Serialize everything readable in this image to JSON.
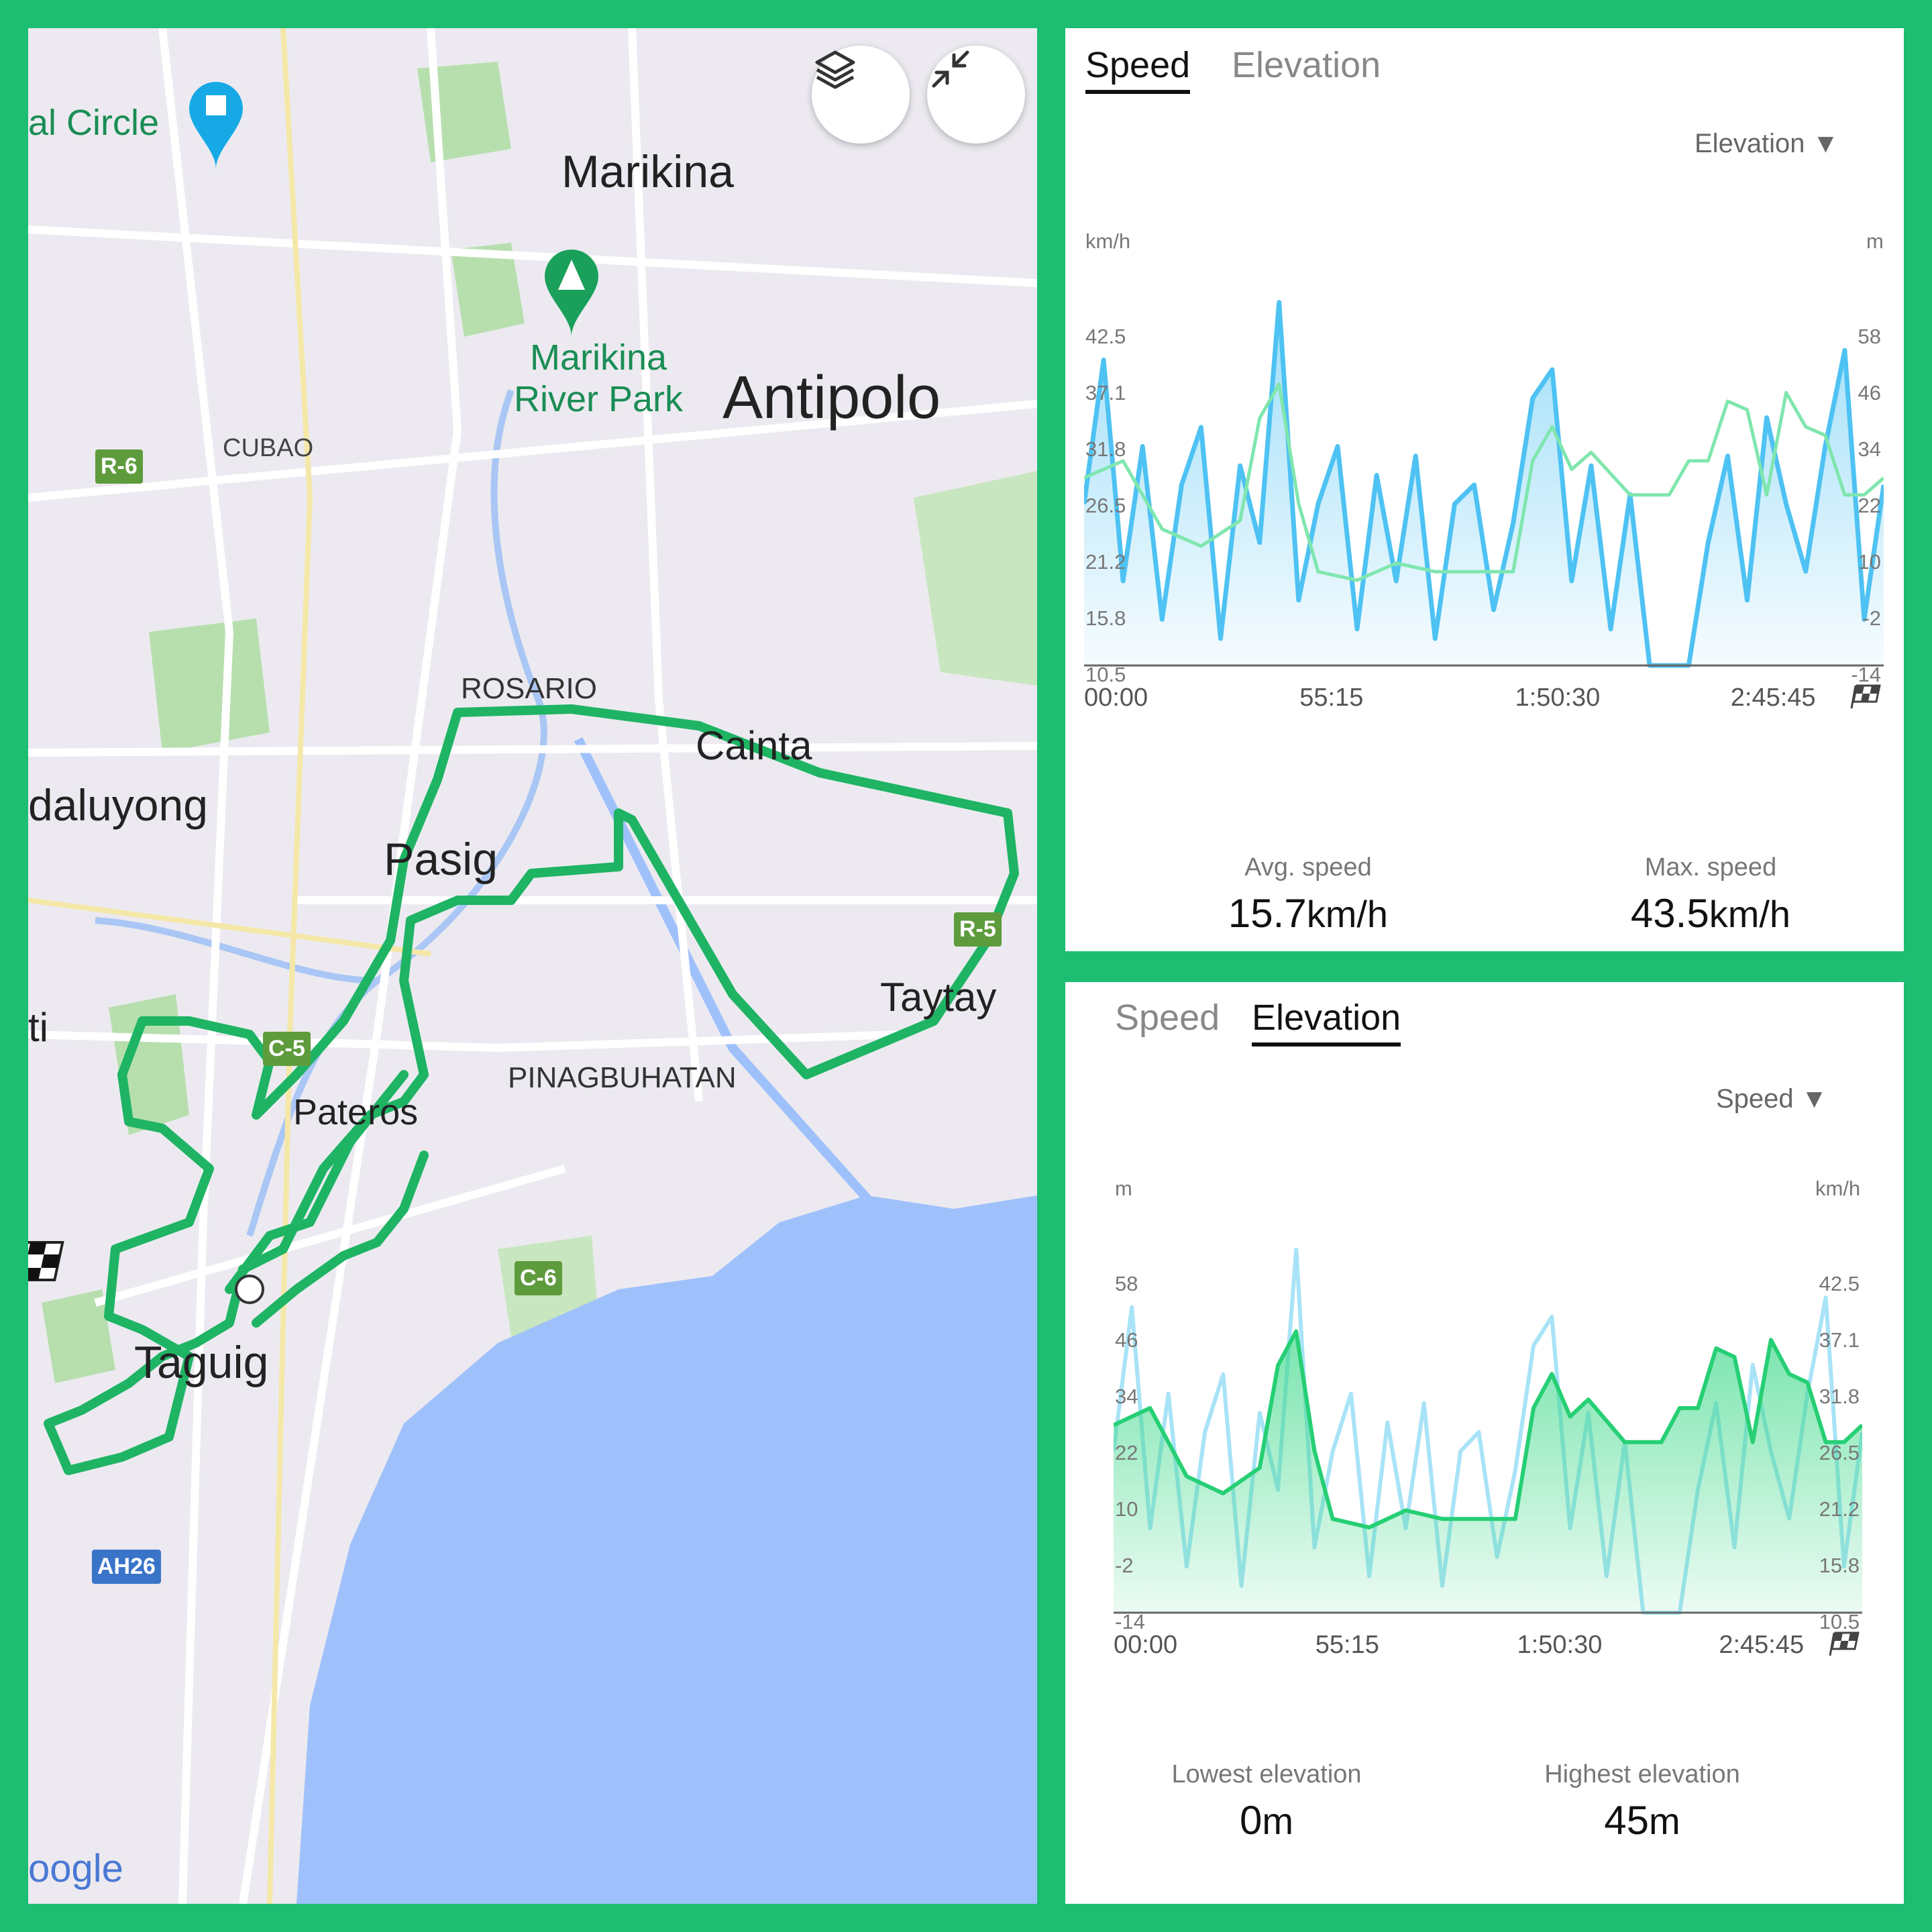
{
  "map": {
    "places": [
      {
        "name": "al Circle"
      },
      {
        "name": "Marikina"
      },
      {
        "name": "Marikina River Park"
      },
      {
        "name": "Antipolo"
      },
      {
        "name": "CUBAO"
      },
      {
        "name": "ROSARIO"
      },
      {
        "name": "Cainta"
      },
      {
        "name": "daluyong"
      },
      {
        "name": "Pasig"
      },
      {
        "name": "Taytay"
      },
      {
        "name": "ti"
      },
      {
        "name": "PINAGBUHATAN"
      },
      {
        "name": "Pateros"
      },
      {
        "name": "Taguig"
      },
      {
        "name": "oogle"
      }
    ],
    "shields": [
      {
        "label": "R-6",
        "color": "#5e9b3c"
      },
      {
        "label": "C-5",
        "color": "#5e9b3c"
      },
      {
        "label": "R-5",
        "color": "#5e9b3c"
      },
      {
        "label": "C-6",
        "color": "#5e9b3c"
      },
      {
        "label": "AH26",
        "color": "#3a74c9"
      }
    ],
    "route_color": "#1eb464",
    "water_color": "#9fc1fb",
    "park_color": "#b7dfae",
    "buttons": [
      {
        "icon": "layers-icon"
      },
      {
        "icon": "collapse-icon"
      }
    ]
  },
  "speed_card": {
    "tabs": [
      {
        "label": "Speed"
      },
      {
        "label": "Elevation"
      }
    ],
    "active_tab": "Speed",
    "dropdown": "Elevation ▼",
    "left_unit": "km/h",
    "right_unit": "m",
    "stats": [
      {
        "label": "Avg. speed",
        "value": "15.7",
        "unit": "km/h"
      },
      {
        "label": "Max. speed",
        "value": "43.5",
        "unit": "km/h"
      }
    ]
  },
  "elevation_card": {
    "tabs": [
      {
        "label": "Speed"
      },
      {
        "label": "Elevation"
      }
    ],
    "active_tab": "Elevation",
    "dropdown": "Speed ▼",
    "left_unit": "m",
    "right_unit": "km/h",
    "stats": [
      {
        "label": "Lowest elevation",
        "value": "0",
        "unit": "m"
      },
      {
        "label": "Highest elevation",
        "value": "45",
        "unit": "m"
      }
    ]
  },
  "chart_data": [
    {
      "type": "area",
      "primary": "speed",
      "x_ticks": [
        "00:00",
        "55:15",
        "1:50:30",
        "2:45:45"
      ],
      "end_marker": "finish-flag-icon",
      "speed_ticks": [
        "42.5",
        "37.1",
        "31.8",
        "26.5",
        "21.2",
        "15.8",
        "10.5"
      ],
      "elevation_ticks": [
        "58",
        "46",
        "34",
        "22",
        "10",
        "-2",
        "-14"
      ],
      "speed_ylim": [
        5.2,
        47.8
      ],
      "elevation_ylim": [
        -26,
        70
      ],
      "x_range_seconds": [
        0,
        12300
      ],
      "speed_color": "#4ec2f3",
      "elevation_color": "#6fe0a4",
      "series": [
        {
          "name": "Speed",
          "unit": "km/h",
          "x": [
            0,
            300,
            600,
            900,
            1200,
            1500,
            1800,
            2100,
            2400,
            2700,
            3000,
            3300,
            3600,
            3900,
            4200,
            4500,
            4800,
            5100,
            5400,
            5700,
            6000,
            6300,
            6600,
            6900,
            7200,
            7500,
            7800,
            8100,
            8400,
            8700,
            9000,
            9300,
            9600,
            9900,
            10200,
            10500,
            10800,
            11100,
            11400,
            11700,
            12000,
            12300
          ],
          "values": [
            22,
            37,
            14,
            28,
            10,
            24,
            30,
            8,
            26,
            18,
            43,
            12,
            22,
            28,
            9,
            25,
            14,
            27,
            8,
            22,
            24,
            11,
            20,
            33,
            36,
            14,
            26,
            9,
            23,
            0,
            0,
            0,
            18,
            27,
            12,
            31,
            22,
            15,
            28,
            38,
            10,
            24
          ]
        },
        {
          "name": "Elevation",
          "unit": "m",
          "x": [
            0,
            600,
            1200,
            1800,
            2400,
            2700,
            3000,
            3300,
            3600,
            4200,
            4800,
            5400,
            6000,
            6600,
            6900,
            7200,
            7500,
            7800,
            8400,
            9000,
            9300,
            9600,
            9900,
            10200,
            10500,
            10800,
            11100,
            11400,
            11700,
            12000,
            12300
          ],
          "values": [
            18,
            22,
            6,
            2,
            8,
            32,
            40,
            12,
            -4,
            -6,
            -2,
            -4,
            -4,
            -4,
            22,
            30,
            20,
            24,
            14,
            14,
            22,
            22,
            36,
            34,
            14,
            38,
            30,
            28,
            14,
            14,
            18
          ]
        }
      ]
    },
    {
      "type": "area",
      "primary": "elevation",
      "x_ticks": [
        "00:00",
        "55:15",
        "1:50:30",
        "2:45:45"
      ],
      "end_marker": "finish-flag-icon",
      "elevation_ticks": [
        "58",
        "46",
        "34",
        "22",
        "10",
        "-2",
        "-14"
      ],
      "speed_ticks": [
        "42.5",
        "37.1",
        "31.8",
        "26.5",
        "21.2",
        "15.8",
        "10.5"
      ],
      "elevation_ylim": [
        -26,
        70
      ],
      "speed_ylim": [
        5.2,
        47.8
      ]
    }
  ]
}
